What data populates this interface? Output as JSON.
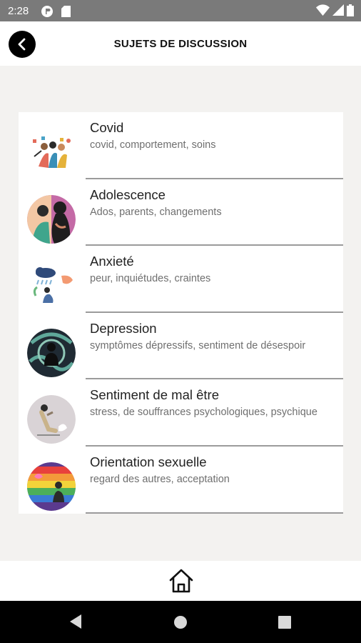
{
  "status_bar": {
    "time": "2:28",
    "icons": [
      "app-notification-icon",
      "sd-card-icon",
      "wifi-icon",
      "signal-icon",
      "battery-icon"
    ]
  },
  "header": {
    "title": "SUJETS DE DISCUSSION",
    "back_icon": "back-arrow-icon"
  },
  "topics": [
    {
      "title": "Covid",
      "subtitle": "covid, comportement, soins",
      "icon": "covid-illustration"
    },
    {
      "title": "Adolescence",
      "subtitle": "Ados, parents, changements",
      "icon": "adolescence-illustration"
    },
    {
      "title": "Anxieté",
      "subtitle": "peur, inquiétudes, craintes",
      "icon": "anxiety-illustration"
    },
    {
      "title": "Depression",
      "subtitle": "symptômes dépressifs, sentiment de désespoir",
      "icon": "depression-illustration"
    },
    {
      "title": "Sentiment de mal être",
      "subtitle": "stress, de souffrances psychologiques, psychique",
      "icon": "malaise-illustration"
    },
    {
      "title": "Orientation sexuelle",
      "subtitle": "regard des autres, acceptation",
      "icon": "orientation-illustration"
    }
  ],
  "bottom_bar": {
    "home_icon": "home-icon"
  },
  "nav_bar": {
    "icons": [
      "back-triangle-icon",
      "home-circle-icon",
      "recents-square-icon"
    ]
  },
  "colors": {
    "status_bar": "#7a7a7a",
    "background": "#f3f2f0",
    "divider": "#9b9b9b",
    "nav_bar": "#000000"
  }
}
